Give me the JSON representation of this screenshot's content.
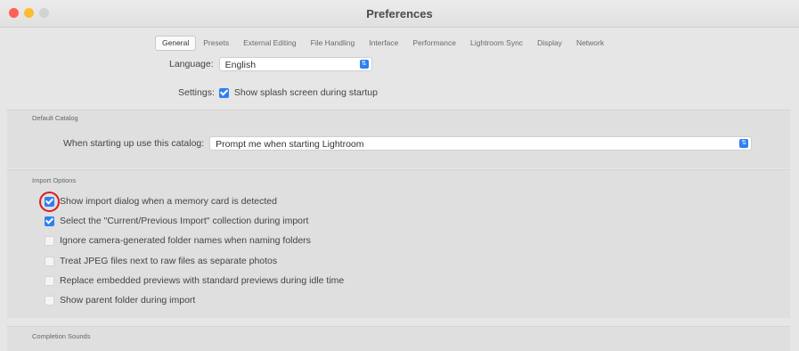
{
  "window": {
    "title": "Preferences"
  },
  "tabs": [
    "General",
    "Presets",
    "External Editing",
    "File Handling",
    "Interface",
    "Performance",
    "Lightroom Sync",
    "Display",
    "Network"
  ],
  "active_tab": "General",
  "general": {
    "language_label": "Language:",
    "language_value": "English",
    "settings_label": "Settings:",
    "splash_label": "Show splash screen during startup",
    "splash_checked": true
  },
  "default_catalog": {
    "section_title": "Default Catalog",
    "label": "When starting up use this catalog:",
    "value": "Prompt me when starting Lightroom"
  },
  "import_options": {
    "section_title": "Import Options",
    "items": [
      {
        "label": "Show import dialog when a memory card is detected",
        "checked": true
      },
      {
        "label": "Select the \"Current/Previous Import\" collection during import",
        "checked": true
      },
      {
        "label": "Ignore camera-generated folder names when naming folders",
        "checked": false
      },
      {
        "label": "Treat JPEG files next to raw files as separate photos",
        "checked": false
      },
      {
        "label": "Replace embedded previews with standard previews during idle time",
        "checked": false
      },
      {
        "label": "Show parent folder during import",
        "checked": false
      }
    ]
  },
  "completion_sounds": {
    "section_title": "Completion Sounds"
  },
  "colors": {
    "accent": "#2f7ff3",
    "highlight_circle": "#d81e1e"
  }
}
